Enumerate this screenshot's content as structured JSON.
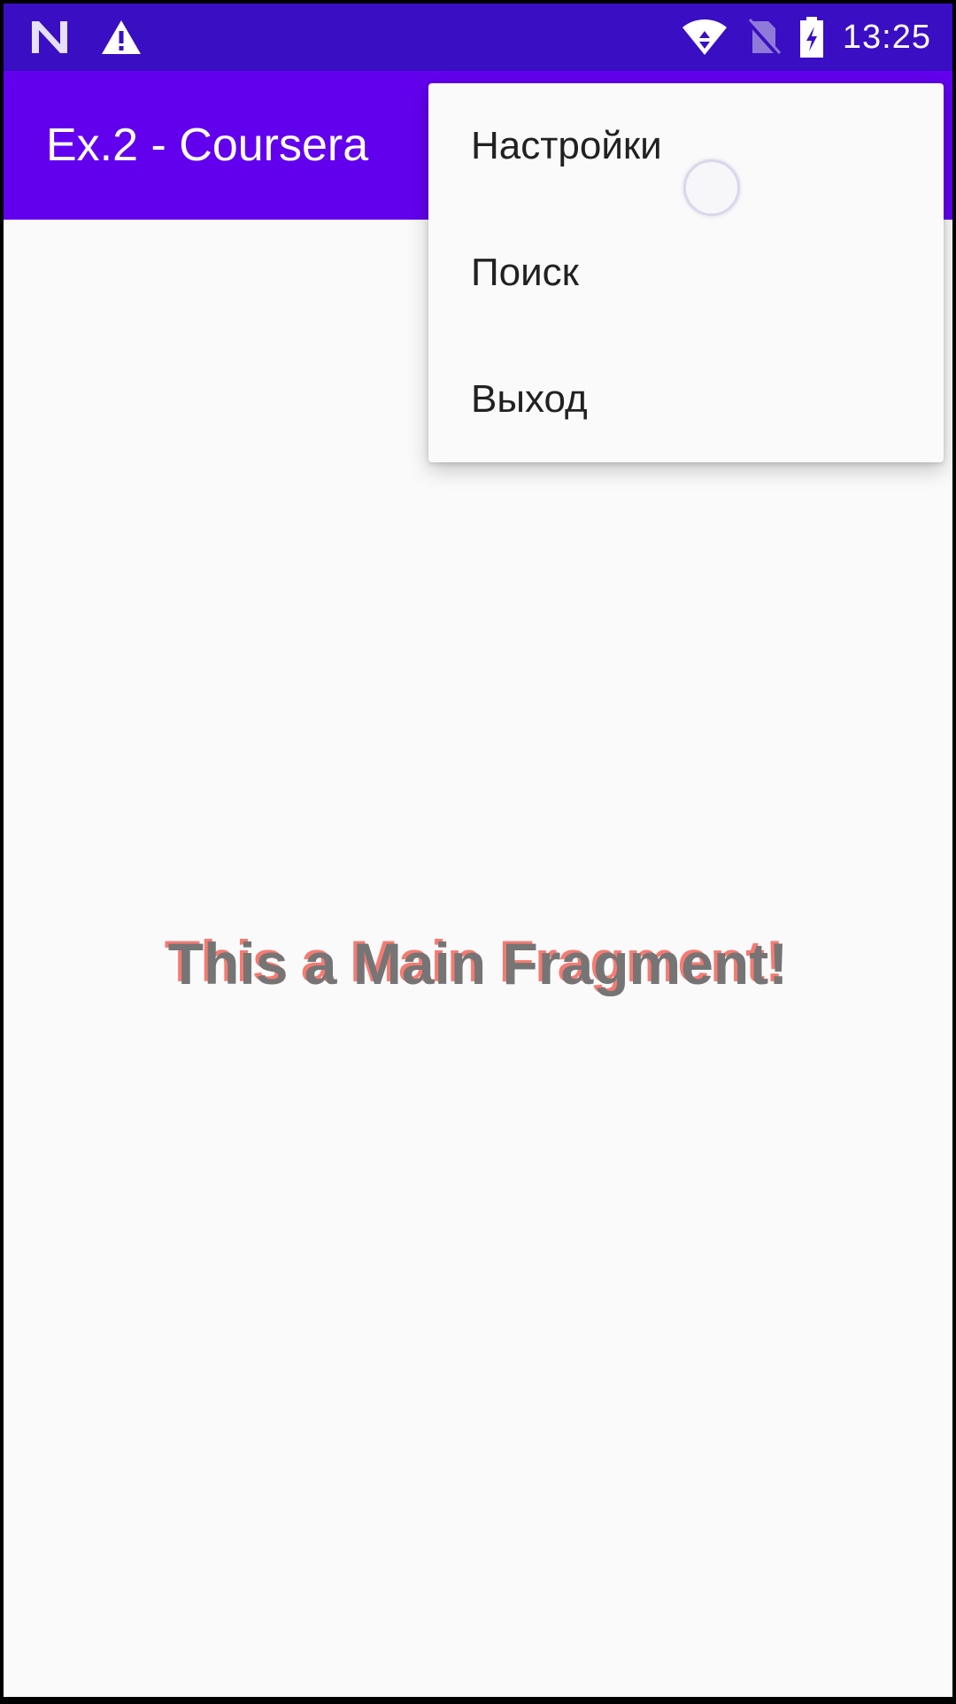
{
  "status_bar": {
    "time": "13:25",
    "left_icons": [
      "n-notification-icon",
      "warning-icon"
    ],
    "right_icons": [
      "wifi-icon",
      "no-sim-icon",
      "battery-charging-icon"
    ]
  },
  "app_bar": {
    "title": "Ex.2 - Coursera",
    "color": "#6200ee"
  },
  "overflow_menu": {
    "items": [
      {
        "label": "Настройки"
      },
      {
        "label": "Поиск"
      },
      {
        "label": "Выход"
      }
    ]
  },
  "main": {
    "fragment_text": "This a Main Fragment!"
  },
  "colors": {
    "status_bar": "#3a0ec2",
    "app_bar": "#6200ee",
    "background": "#fafafa",
    "text_gray": "#757575",
    "text_shadow_red": "#f44336"
  }
}
